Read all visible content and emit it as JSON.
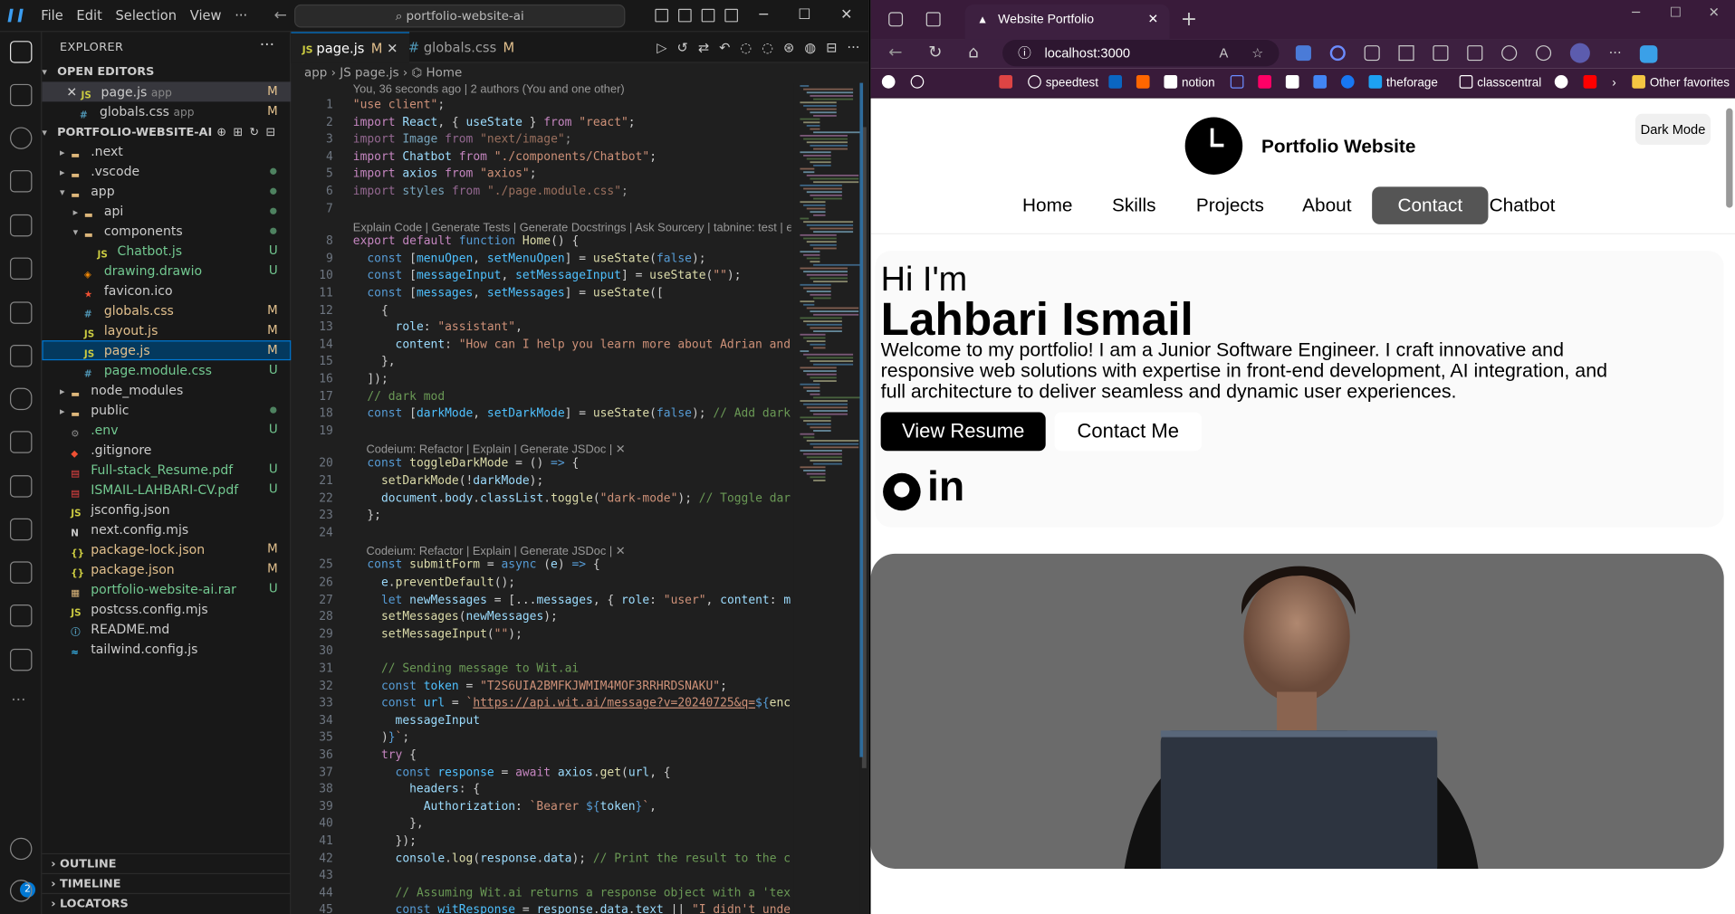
{
  "vscode": {
    "menu": [
      "File",
      "Edit",
      "Selection",
      "View",
      "···"
    ],
    "command_center": "⌕ portfolio-website-ai",
    "explorer_title": "EXPLORER",
    "open_editors_title": "OPEN EDITORS",
    "open_editors": [
      {
        "name": "page.js",
        "folder": "app",
        "status": "M"
      },
      {
        "name": "globals.css",
        "folder": "app",
        "status": "M"
      }
    ],
    "project_title": "PORTFOLIO-WEBSITE-AI",
    "tree": [
      {
        "name": ".next",
        "kind": "folder",
        "depth": 0,
        "status": ""
      },
      {
        "name": ".vscode",
        "kind": "folder",
        "depth": 0,
        "status": "dot"
      },
      {
        "name": "app",
        "kind": "folder-open",
        "depth": 0,
        "status": "dot"
      },
      {
        "name": "api",
        "kind": "folder",
        "depth": 1,
        "status": "dot"
      },
      {
        "name": "components",
        "kind": "folder-open",
        "depth": 1,
        "status": "dot"
      },
      {
        "name": "Chatbot.js",
        "kind": "js",
        "depth": 2,
        "status": "U"
      },
      {
        "name": "drawing.drawio",
        "kind": "drawio",
        "depth": 1,
        "status": "U"
      },
      {
        "name": "favicon.ico",
        "kind": "ico",
        "depth": 1,
        "status": ""
      },
      {
        "name": "globals.css",
        "kind": "css",
        "depth": 1,
        "status": "M"
      },
      {
        "name": "layout.js",
        "kind": "js",
        "depth": 1,
        "status": "M"
      },
      {
        "name": "page.js",
        "kind": "js",
        "depth": 1,
        "status": "M"
      },
      {
        "name": "page.module.css",
        "kind": "css",
        "depth": 1,
        "status": "U"
      },
      {
        "name": "node_modules",
        "kind": "folder",
        "depth": 0,
        "status": ""
      },
      {
        "name": "public",
        "kind": "folder",
        "depth": 0,
        "status": "dot"
      },
      {
        "name": ".env",
        "kind": "gear",
        "depth": 0,
        "status": "U"
      },
      {
        "name": ".gitignore",
        "kind": "git",
        "depth": 0,
        "status": ""
      },
      {
        "name": "Full-stack_Resume.pdf",
        "kind": "pdf",
        "depth": 0,
        "status": "U"
      },
      {
        "name": "ISMAIL-LAHBARI-CV.pdf",
        "kind": "pdf",
        "depth": 0,
        "status": "U"
      },
      {
        "name": "jsconfig.json",
        "kind": "js",
        "depth": 0,
        "status": ""
      },
      {
        "name": "next.config.mjs",
        "kind": "next",
        "depth": 0,
        "status": ""
      },
      {
        "name": "package-lock.json",
        "kind": "json",
        "depth": 0,
        "status": "M"
      },
      {
        "name": "package.json",
        "kind": "json",
        "depth": 0,
        "status": "M"
      },
      {
        "name": "portfolio-website-ai.rar",
        "kind": "rar",
        "depth": 0,
        "status": "U"
      },
      {
        "name": "postcss.config.mjs",
        "kind": "js",
        "depth": 0,
        "status": ""
      },
      {
        "name": "README.md",
        "kind": "md",
        "depth": 0,
        "status": ""
      },
      {
        "name": "tailwind.config.js",
        "kind": "tw",
        "depth": 0,
        "status": ""
      }
    ],
    "bottom_sections": [
      "OUTLINE",
      "TIMELINE",
      "LOCATORS"
    ],
    "tabs": [
      {
        "name": "page.js",
        "status": "M"
      },
      {
        "name": "globals.css",
        "status": "M"
      }
    ],
    "breadcrumb": "app  ›  JS page.js  ›  ⌬ Home",
    "blame": "You, 36 seconds ago | 2 authors (You and one other)",
    "lens_explain": "Explain Code | Generate Tests | Generate Docstrings | Ask Sourcery | tabnine: test | explain | d",
    "lens_codeium": "Codeium: Refactor | Explain | Generate JSDoc | ✕"
  },
  "browser": {
    "tab_title": "Website Portfolio",
    "url": "localhost:3000",
    "favorites": [
      "speedtest",
      "notion",
      "theforage",
      "classcentral"
    ],
    "other_favorites": "Other favorites"
  },
  "site": {
    "logo_letter": "L",
    "title": "Portfolio Website",
    "dark_mode": "Dark Mode",
    "nav": [
      "Home",
      "Skills",
      "Projects",
      "About",
      "Contact",
      "Chatbot"
    ],
    "active_nav": "Contact",
    "hi": "Hi I'm",
    "name": "Lahbari Ismail",
    "intro": "Welcome to my portfolio! I am a Junior Software Engineer. I craft innovative and responsive web solutions with expertise in front-end development, AI integration, and full architecture to deliver seamless and dynamic user experiences.",
    "btn_resume": "View Resume",
    "btn_contact": "Contact Me",
    "linkedin_text": "in"
  },
  "colors": {
    "accent": "#0078d4",
    "browser_chrome": "#391b3a",
    "active_nav_bg": "#555555",
    "photo_bg": "#6b6b6b"
  }
}
